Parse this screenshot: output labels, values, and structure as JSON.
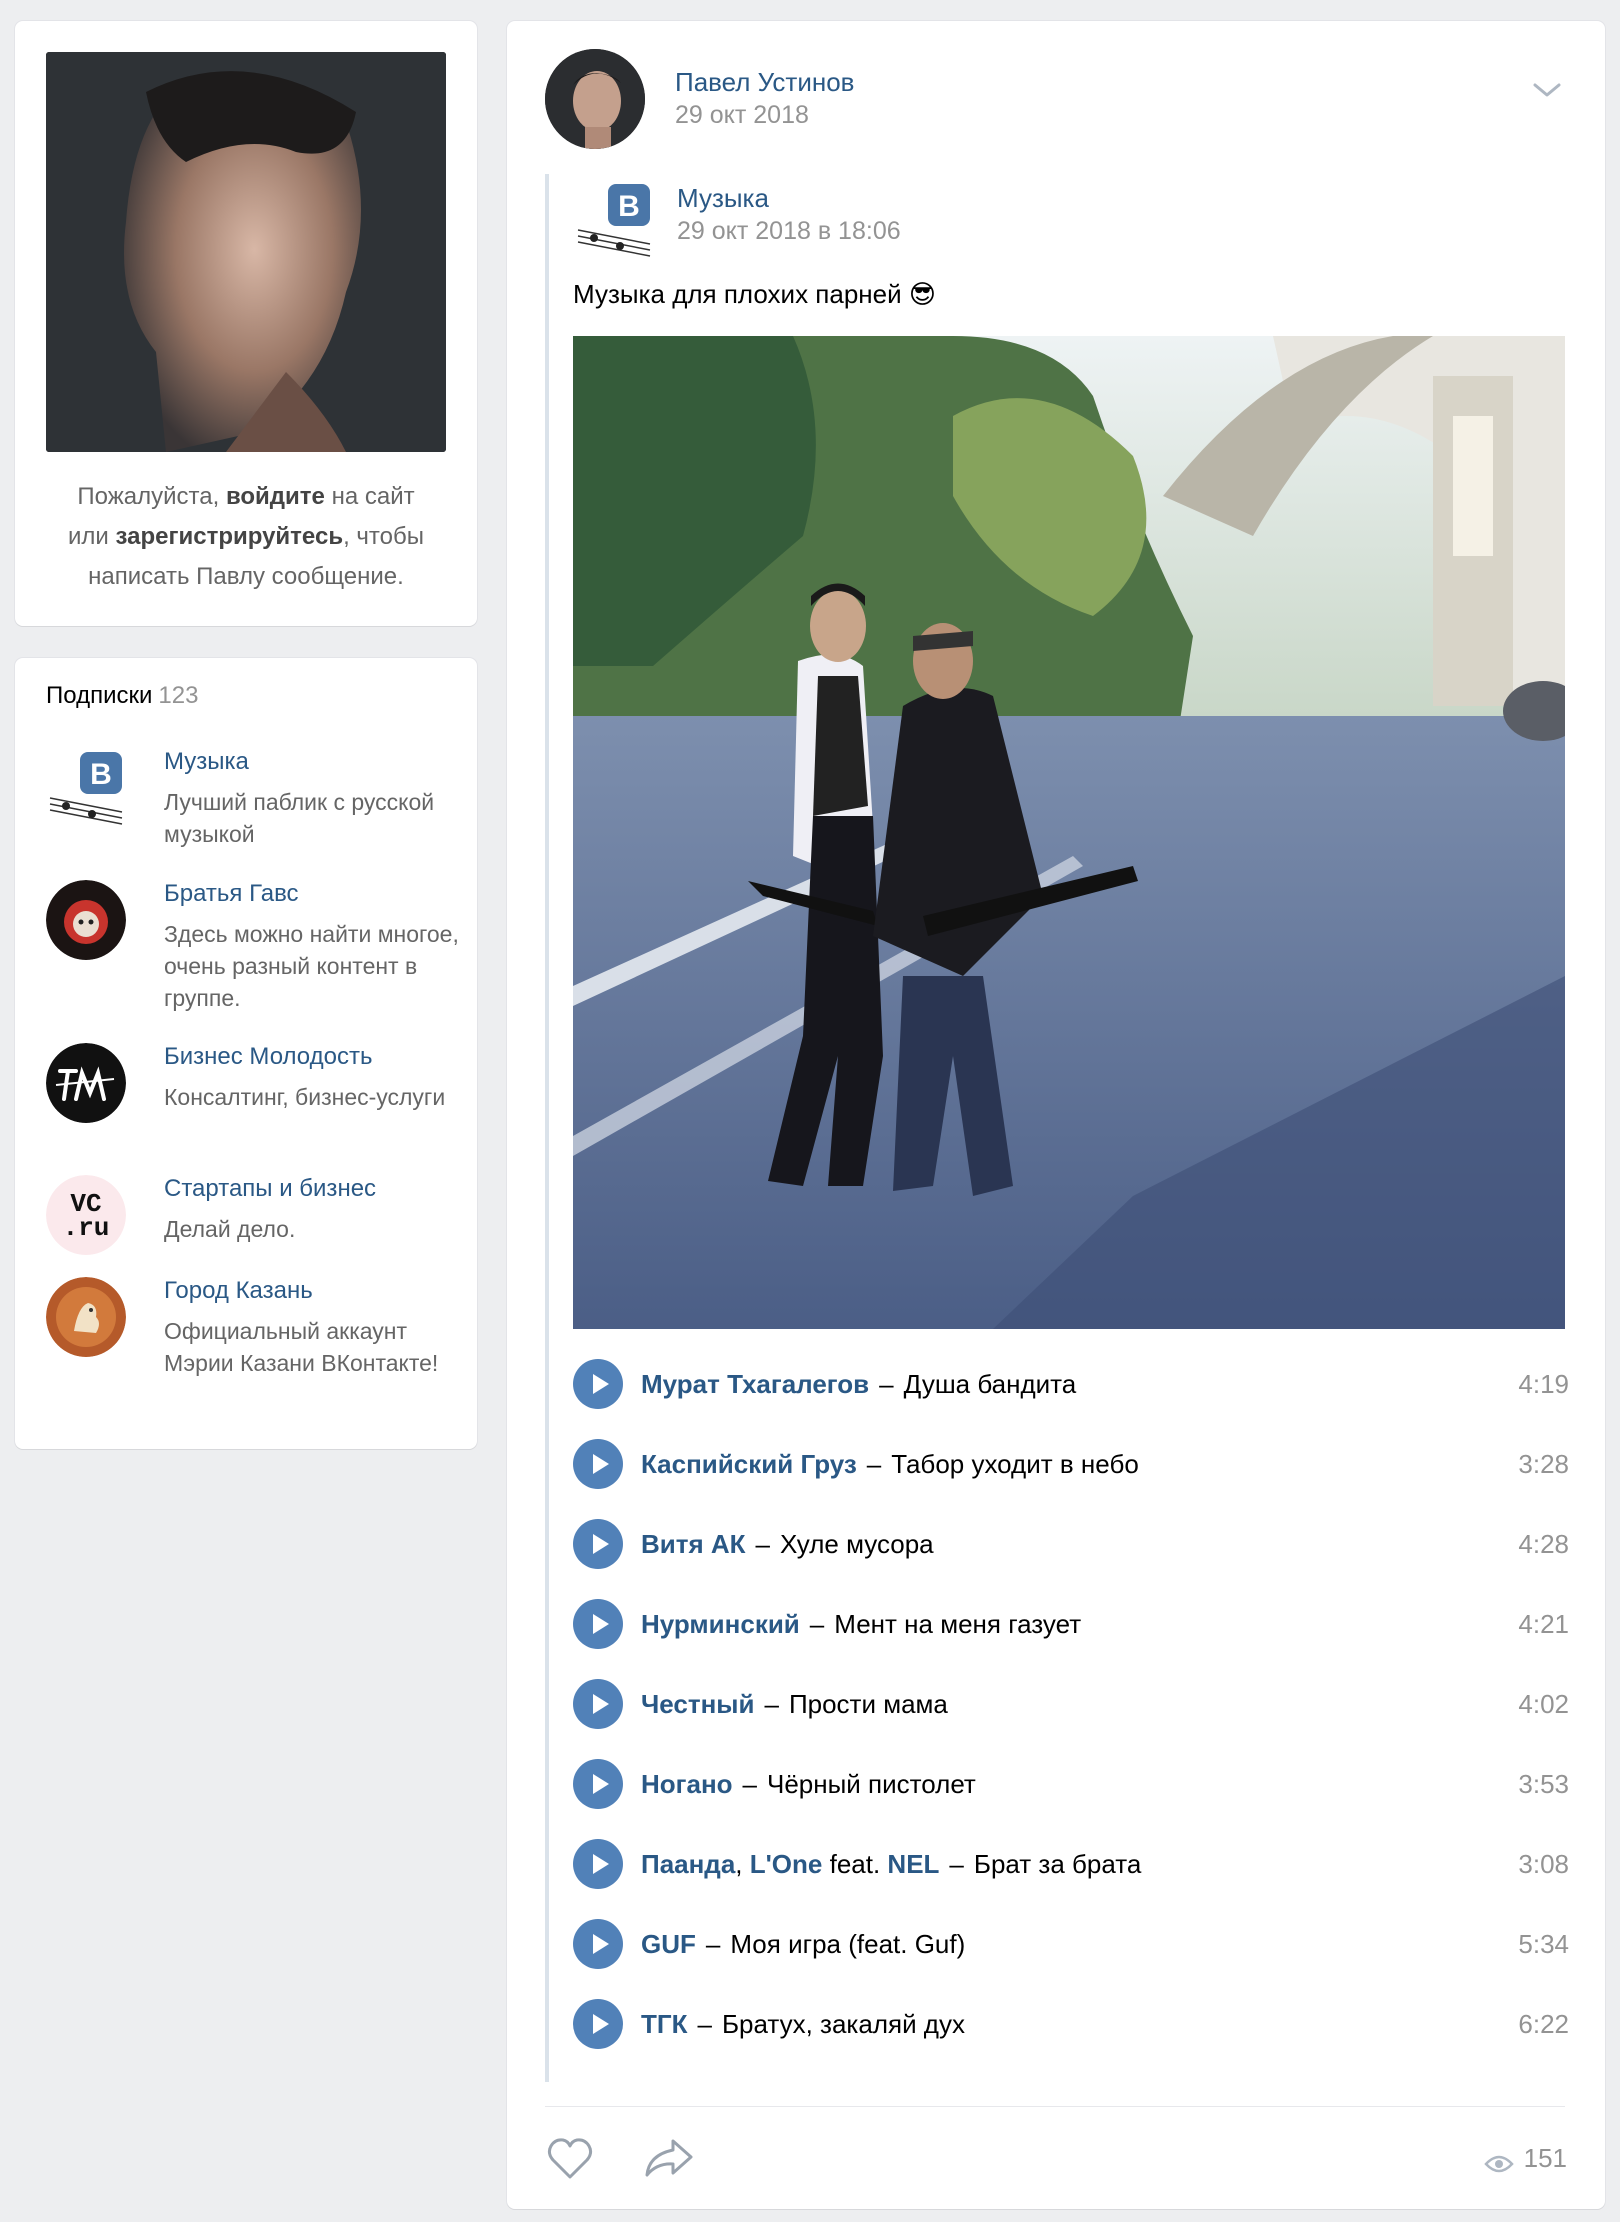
{
  "profile": {
    "hint_1": "Пожалуйста, ",
    "hint_login": "войдите",
    "hint_2": " на сайт",
    "hint_3": "или ",
    "hint_register": "зарегистрируйтесь",
    "hint_4": ", чтобы",
    "hint_5": "написать Павлу сообщение."
  },
  "subscriptions": {
    "title": "Подписки",
    "count": "123",
    "items": [
      {
        "name": "Музыка",
        "desc": "Лучший паблик с русской музыкой"
      },
      {
        "name": "Братья Гавс",
        "desc": "Здесь можно найти многое, очень разный контент в группе."
      },
      {
        "name": "Бизнес Молодость",
        "desc": "Консалтинг, бизнес-услуги"
      },
      {
        "name": "Стартапы и бизнес",
        "desc": "Делай дело."
      },
      {
        "name": "Город Казань",
        "desc": "Официальный аккаунт Мэрии Казани ВКонтакте!"
      }
    ]
  },
  "post": {
    "author": "Павел Устинов",
    "date": "29 окт 2018",
    "group_name": "Музыка",
    "group_date": "29 окт 2018 в 18:06",
    "text": "Музыка для плохих парней 😎",
    "tracks": [
      {
        "artist": "Мурат Тхагалегов",
        "title": "Душа бандита",
        "duration": "4:19"
      },
      {
        "artist": "Каспийский Груз",
        "title": "Табор уходит в небо",
        "duration": "3:28"
      },
      {
        "artist": "Витя АК",
        "title": "Хуле мусора",
        "duration": "4:28"
      },
      {
        "artist": "Нурминский",
        "title": "Мент на меня газует",
        "duration": "4:21"
      },
      {
        "artist": "Честный",
        "title": "Прости мама",
        "duration": "4:02"
      },
      {
        "artist": "Ногано",
        "title": "Чёрный пистолет",
        "duration": "3:53"
      },
      {
        "artist": "Паанда",
        "artist_sep": ", ",
        "artist_2": "L'One",
        "feat_word": " feat. ",
        "artist_3": "NEL",
        "title": "Брат за брата",
        "duration": "3:08"
      },
      {
        "artist": "GUF",
        "title": "Моя игра (feat. Guf)",
        "duration": "5:34"
      },
      {
        "artist": "ТГК",
        "title": "Братух, закаляй дух",
        "duration": "6:22"
      }
    ],
    "dash": "–",
    "views": "151"
  },
  "colors": {
    "link": "#2a5885",
    "accent": "#5181b8",
    "muted": "#939393",
    "background": "#edeef0"
  },
  "icons": [
    "chevron-down-icon",
    "play-icon",
    "heart-icon",
    "share-arrow-icon",
    "eye-icon",
    "vk-logo-icon"
  ]
}
